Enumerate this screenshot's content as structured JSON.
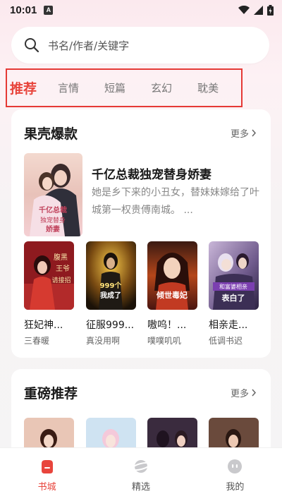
{
  "status": {
    "time": "10:01",
    "a_label": "A"
  },
  "search": {
    "placeholder": "书名/作者/关键字"
  },
  "tabs": [
    "推荐",
    "言情",
    "短篇",
    "玄幻",
    "耽美"
  ],
  "section1": {
    "title": "果壳爆款",
    "more": "更多",
    "featured": {
      "title": "千亿总裁独宠替身娇妻",
      "description": "她是乡下来的小丑女，替妹妹嫁给了叶城第一权贵傅南城。 ...",
      "cover_text": "千亿总裁独宠替身娇妻"
    },
    "books": [
      {
        "title": "狂妃神...",
        "author": "三春暖",
        "cover_text": "腹黑王爷请接招"
      },
      {
        "title": "征服999...",
        "author": "真没用啊",
        "cover_text": "999个女神后我成了霸主"
      },
      {
        "title": "嗷呜！...",
        "author": "噗噗叽叽",
        "cover_text": "倾世毒妃"
      },
      {
        "title": "相亲走...",
        "author": "低调书迟",
        "cover_text": "和富婆相亲被反向表白了"
      }
    ]
  },
  "section2": {
    "title": "重磅推荐",
    "more": "更多"
  },
  "nav": [
    {
      "label": "书城",
      "active": true
    },
    {
      "label": "精选",
      "active": false
    },
    {
      "label": "我的",
      "active": false
    }
  ],
  "colors": {
    "accent": "#e8453c",
    "highlight_border": "#e53935"
  }
}
